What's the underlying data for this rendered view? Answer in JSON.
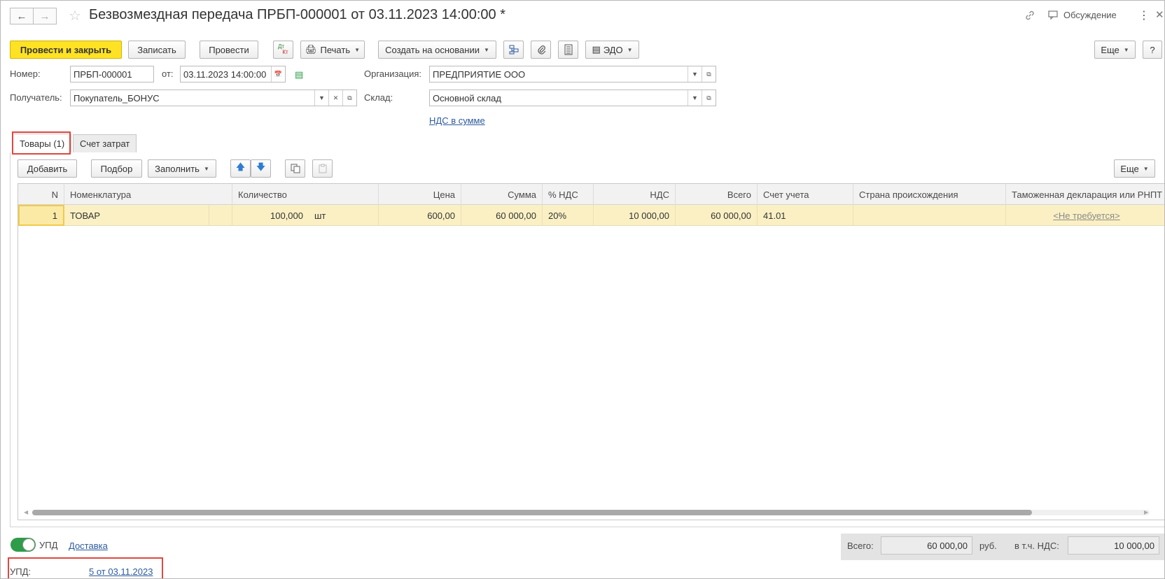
{
  "window": {
    "title": "Безвозмездная передача ПРБП-000001 от 03.11.2023 14:00:00 *",
    "discussion": "Обсуждение"
  },
  "toolbar": {
    "post_close": "Провести и закрыть",
    "save": "Записать",
    "post": "Провести",
    "dtkt_top": "Дт",
    "dtkt_bottom": "Кт",
    "print": "Печать",
    "create_based": "Создать на основании",
    "edo": "ЭДО",
    "more": "Еще",
    "help": "?"
  },
  "form": {
    "number_label": "Номер:",
    "number_value": "ПРБП-000001",
    "date_label": "от:",
    "date_value": "03.11.2023 14:00:00",
    "org_label": "Организация:",
    "org_value": "ПРЕДПРИЯТИЕ ООО",
    "recipient_label": "Получатель:",
    "recipient_value": "Покупатель_БОНУС",
    "warehouse_label": "Склад:",
    "warehouse_value": "Основной склад",
    "vat_link": "НДС в сумме"
  },
  "tabs": [
    {
      "label": "Товары (1)",
      "active": true
    },
    {
      "label": "Счет затрат",
      "active": false
    }
  ],
  "table_toolbar": {
    "add": "Добавить",
    "pick": "Подбор",
    "fill": "Заполнить",
    "more": "Еще"
  },
  "table": {
    "headers": [
      "N",
      "Номенклатура",
      "Количество",
      "Цена",
      "Сумма",
      "% НДС",
      "НДС",
      "Всего",
      "Счет учета",
      "Страна происхождения",
      "Таможенная декларация или РНПТ"
    ],
    "rows": [
      {
        "n": "1",
        "item": "ТОВАР",
        "qty": "100,000",
        "unit": "шт",
        "price": "600,00",
        "sum": "60 000,00",
        "vat_rate": "20%",
        "vat": "10 000,00",
        "total": "60 000,00",
        "account": "41.01",
        "country": "",
        "customs": "<Не требуется>"
      }
    ]
  },
  "footer": {
    "upd_toggle_label": "УПД",
    "delivery_link": "Доставка",
    "upd_label": "УПД:",
    "upd_link": "5 от 03.11.2023",
    "total_label": "Всего:",
    "total_value": "60 000,00",
    "currency": "руб.",
    "vat_label": "в т.ч. НДС:",
    "vat_value": "10 000,00"
  },
  "colors": {
    "primary_button": "#ffe224",
    "row_highlight": "#fbf0c4",
    "link": "#2c5aa0",
    "toggle_on": "#2e9c49",
    "annotation_red": "#e0473f"
  }
}
